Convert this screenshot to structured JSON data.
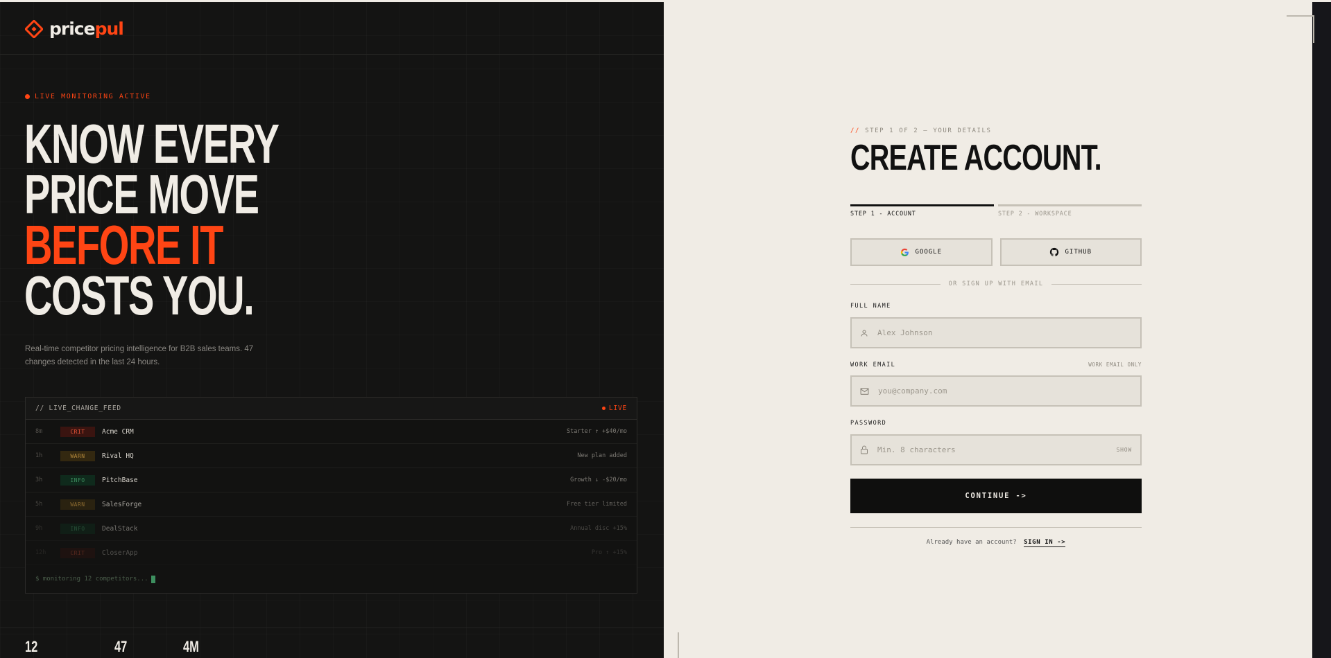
{
  "brand": {
    "name_prefix": "price",
    "name_suffix": "pul",
    "accent_color": "#ff4514"
  },
  "hero": {
    "live_tag": "LIVE MONITORING ACTIVE",
    "headline_line1": "KNOW EVERY",
    "headline_line2": "PRICE MOVE",
    "headline_line3": "BEFORE IT",
    "headline_line4": "COSTS YOU.",
    "description": "Real-time competitor pricing intelligence for B2B sales teams. 47 changes detected in the last 24 hours."
  },
  "feed": {
    "title": "// LIVE_CHANGE_FEED",
    "live_label": "LIVE",
    "rows": [
      {
        "time": "8m",
        "severity": "CRIT",
        "company": "Acme CRM",
        "change": "Starter ↑ +$40/mo"
      },
      {
        "time": "1h",
        "severity": "WARN",
        "company": "Rival HQ",
        "change": "New plan added"
      },
      {
        "time": "3h",
        "severity": "INFO",
        "company": "PitchBase",
        "change": "Growth ↓ -$20/mo"
      },
      {
        "time": "5h",
        "severity": "WARN",
        "company": "SalesForge",
        "change": "Free tier limited"
      },
      {
        "time": "9h",
        "severity": "INFO",
        "company": "DealStack",
        "change": "Annual disc +15%"
      },
      {
        "time": "12h",
        "severity": "CRIT",
        "company": "CloserApp",
        "change": "Pro ↑ +15%"
      }
    ],
    "footer": "$ monitoring 12 competitors..."
  },
  "stats": {
    "competitors": "12",
    "changes": "47",
    "volume": "4M"
  },
  "form": {
    "step_prefix": "//",
    "step_label": "STEP 1 OF 2 — YOUR DETAILS",
    "title": "CREATE ACCOUNT.",
    "steps": [
      {
        "label": "STEP 1 - ACCOUNT",
        "active": true
      },
      {
        "label": "STEP 2 - WORKSPACE",
        "active": false
      }
    ],
    "google_label": "GOOGLE",
    "github_label": "GITHUB",
    "divider_label": "OR SIGN UP WITH EMAIL",
    "full_name": {
      "label": "FULL NAME",
      "placeholder": "Alex Johnson",
      "value": ""
    },
    "email": {
      "label": "WORK EMAIL",
      "hint": "WORK EMAIL ONLY",
      "placeholder": "you@company.com",
      "value": ""
    },
    "password": {
      "label": "PASSWORD",
      "placeholder": "Min. 8 characters",
      "value": "",
      "toggle": "SHOW"
    },
    "continue_label": "CONTINUE ->",
    "signin_prompt": "Already have an account?",
    "signin_link": "SIGN IN ->"
  }
}
